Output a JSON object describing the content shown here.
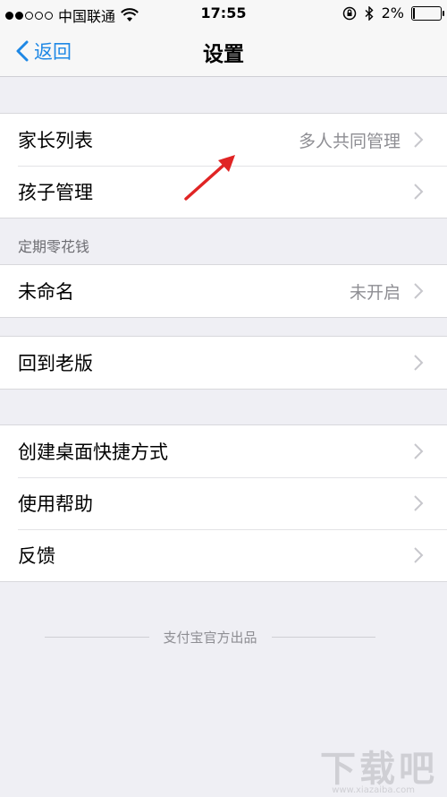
{
  "status": {
    "carrier": "中国联通",
    "time": "17:55",
    "battery": "2%",
    "battery_level": 0.02,
    "icons": [
      "signal-dots",
      "wifi-icon",
      "lock-rotation-icon",
      "bluetooth-icon",
      "battery-icon"
    ]
  },
  "nav": {
    "back_label": "返回",
    "title": "设置"
  },
  "groups": {
    "g1": [
      {
        "label": "家长列表",
        "value": "多人共同管理"
      },
      {
        "label": "孩子管理",
        "value": ""
      }
    ],
    "section_header": "定期零花钱",
    "g2": [
      {
        "label": "未命名",
        "value": "未开启"
      }
    ],
    "g3": [
      {
        "label": "回到老版",
        "value": ""
      }
    ],
    "g4": [
      {
        "label": "创建桌面快捷方式",
        "value": ""
      },
      {
        "label": "使用帮助",
        "value": ""
      },
      {
        "label": "反馈",
        "value": ""
      }
    ]
  },
  "footer": "支付宝官方出品",
  "watermark": "下载吧",
  "watermark_url": "www.xiazaiba.com",
  "colors": {
    "accent": "#1e88e5",
    "background": "#efeff4",
    "secondary_text": "#8e8e93",
    "annotation_arrow": "#e02424"
  }
}
